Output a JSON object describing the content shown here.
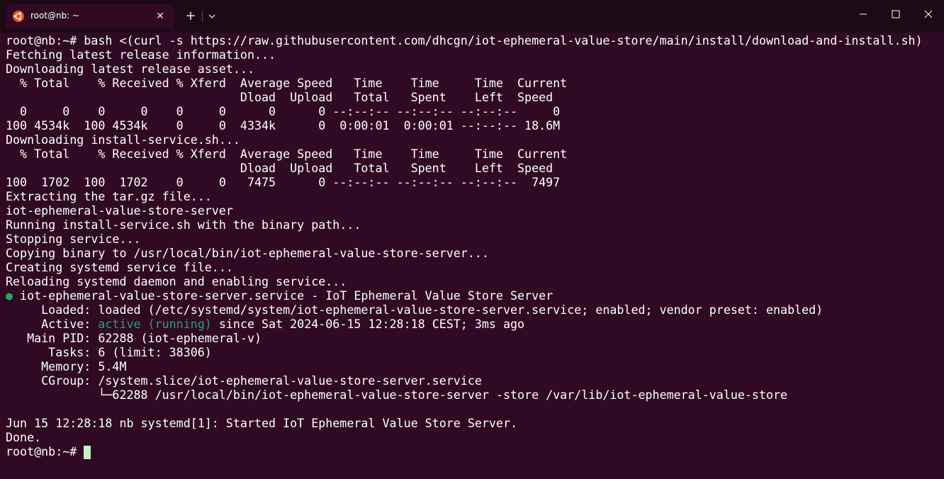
{
  "window": {
    "tab_title": "root@nb: ~",
    "tab_icon": "ubuntu-logo-icon",
    "new_tab_icon": "plus-icon",
    "dropdown_icon": "chevron-down-icon",
    "close_tab_icon": "close-icon",
    "controls": [
      "minimize-icon",
      "maximize-icon",
      "close-icon"
    ],
    "accent_color": "#e95420",
    "background_color": "#300a24"
  },
  "terminal": {
    "lines": [
      "root@nb:~# bash <(curl -s https://raw.githubusercontent.com/dhcgn/iot-ephemeral-value-store/main/install/download-and-install.sh)",
      "Fetching latest release information...",
      "Downloading latest release asset...",
      "  % Total    % Received % Xferd  Average Speed   Time    Time     Time  Current",
      "                                 Dload  Upload   Total   Spent    Left  Speed",
      "  0     0    0     0    0     0      0      0 --:--:-- --:--:-- --:--:--     0",
      "100 4534k  100 4534k    0     0  4334k      0  0:00:01  0:00:01 --:--:-- 18.6M",
      "Downloading install-service.sh...",
      "  % Total    % Received % Xferd  Average Speed   Time    Time     Time  Current",
      "                                 Dload  Upload   Total   Spent    Left  Speed",
      "100  1702  100  1702    0     0   7475      0 --:--:-- --:--:-- --:--:--  7497",
      "Extracting the tar.gz file...",
      "iot-ephemeral-value-store-server",
      "Running install-service.sh with the binary path...",
      "Stopping service...",
      "Copying binary to /usr/local/bin/iot-ephemeral-value-store-server...",
      "Creating systemd service file...",
      "Reloading systemd daemon and enabling service..."
    ],
    "status_bullet": "●",
    "status_service_line": " iot-ephemeral-value-store-server.service - IoT Ephemeral Value Store Server",
    "loaded_line": "     Loaded: loaded (/etc/systemd/system/iot-ephemeral-value-store-server.service; enabled; vendor preset: enabled)",
    "active_prefix": "     Active: ",
    "active_state": "active (running)",
    "active_suffix": " since Sat 2024-06-15 12:28:18 CEST; 3ms ago",
    "details": [
      "   Main PID: 62288 (iot-ephemeral-v)",
      "      Tasks: 6 (limit: 38306)",
      "     Memory: 5.4M",
      "     CGroup: /system.slice/iot-ephemeral-value-store-server.service",
      "             └─62288 /usr/local/bin/iot-ephemeral-value-store-server -store /var/lib/iot-ephemeral-value-store"
    ],
    "log_line": "Jun 15 12:28:18 nb systemd[1]: Started IoT Ephemeral Value Store Server.",
    "done_line": "Done.",
    "prompt": "root@nb:~# ",
    "status_active_color": "#26a269"
  }
}
